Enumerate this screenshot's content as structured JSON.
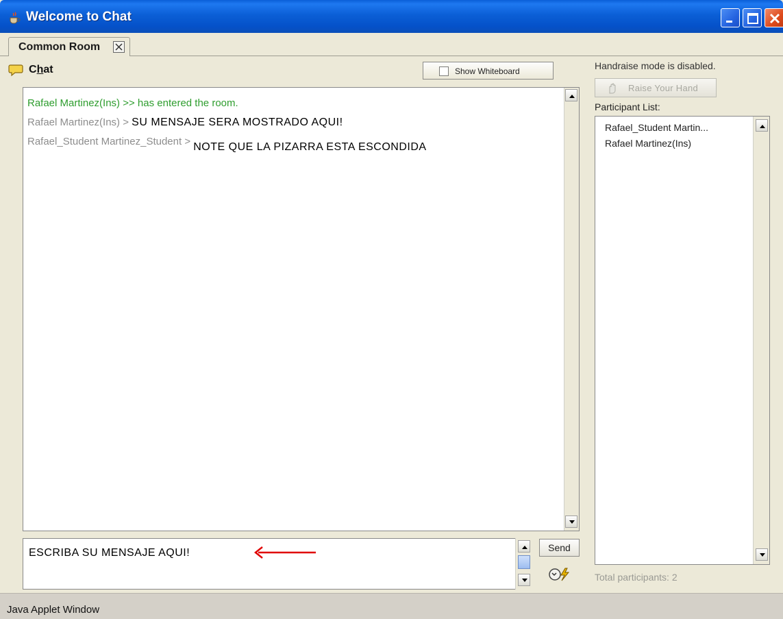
{
  "window": {
    "title": "Welcome to Chat"
  },
  "tabs": [
    {
      "label": "Common Room"
    }
  ],
  "chat": {
    "label_prefix": "C",
    "label_mnemonic": "h",
    "label_suffix": "at",
    "show_whiteboard_label": "Show Whiteboard",
    "show_whiteboard_checked": false,
    "messages": [
      {
        "sender": "Rafael Martinez(Ins) >>",
        "text": "has entered the room.",
        "kind": "system"
      },
      {
        "sender": "Rafael Martinez(Ins) >",
        "text": "SU MENSAJE SERA MOSTRADO AQUI!",
        "kind": "message"
      },
      {
        "sender": "Rafael_Student Martinez_Student >",
        "text": "NOTE QUE LA PIZARRA ESTA ESCONDIDA",
        "kind": "message"
      }
    ],
    "input_value": "ESCRIBA SU MENSAJE AQUI!",
    "send_label": "Send"
  },
  "sidebar": {
    "handraise_status": "Handraise mode is disabled.",
    "raise_hand_label": "Raise Your Hand",
    "participant_list_label": "Participant List:",
    "participants": [
      "Rafael_Student Martin...",
      "Rafael Martinez(Ins)"
    ],
    "total_participants": "Total participants: 2"
  },
  "statusbar": {
    "text": "Java Applet Window"
  },
  "colors": {
    "titlebar": "#0A5FD8",
    "system_message": "#2E9D2E",
    "sender": "#8D8D8D",
    "annotation_arrow": "#E00000"
  },
  "icons": {
    "title": "java-cup-icon",
    "chat": "speech-bubble-icon",
    "raise_hand": "hand-icon",
    "emoticon": "emoticon-icon"
  }
}
